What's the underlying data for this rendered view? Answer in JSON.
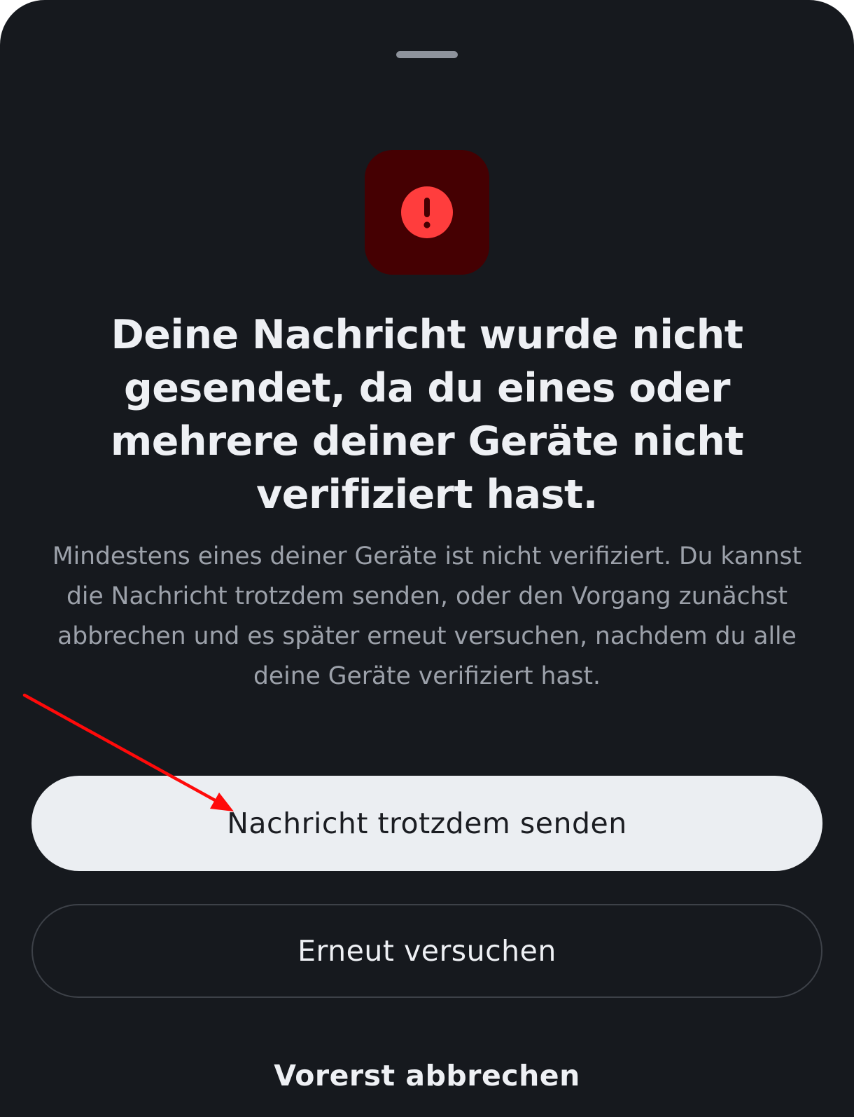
{
  "sheet": {
    "title": "Deine Nachricht wurde nicht gesendet, da du eines oder mehrere deiner Geräte nicht verifiziert hast.",
    "body": "Mindestens eines deiner Geräte ist nicht verifiziert. Du kannst die Nachricht trotzdem senden, oder den Vorgang zunächst abbrechen und es später erneut versuchen, nachdem du alle deine Geräte verifiziert hast.",
    "icon": "error-exclamation-icon",
    "icon_color": "#ff3d3d",
    "icon_tile_color": "#450002"
  },
  "actions": {
    "send_anyway_label": "Nachricht trotzdem senden",
    "retry_label": "Erneut versuchen",
    "cancel_label": "Vorerst abbrechen"
  },
  "colors": {
    "background": "#16191e",
    "primary_button": "#ebeef2",
    "annotation_arrow": "#ff0a0a"
  }
}
